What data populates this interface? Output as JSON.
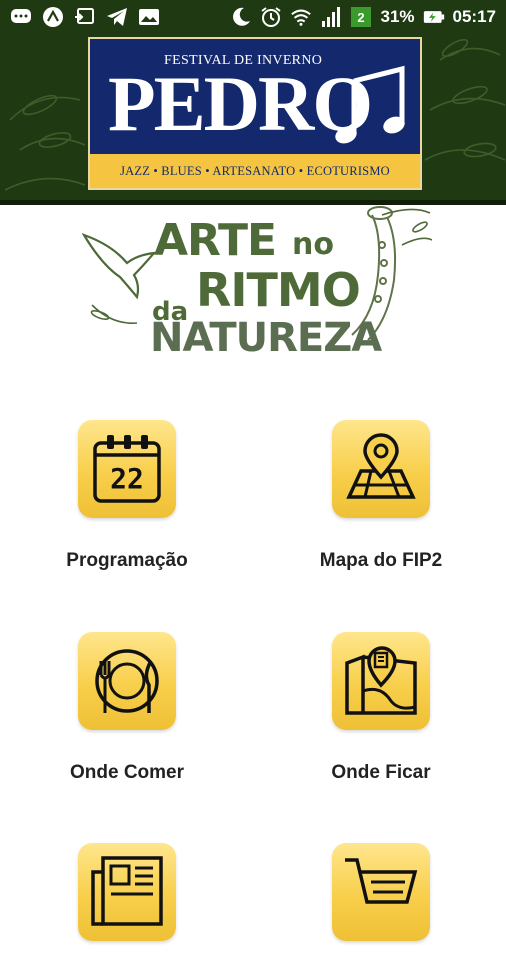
{
  "status_bar": {
    "left_icons": [
      "chat-bubble-icon",
      "a-circle-icon",
      "cast-icon",
      "telegram-icon",
      "image-icon"
    ],
    "right_icons": [
      "moon-icon",
      "alarm-icon",
      "wifi-icon",
      "signal-icon",
      "signal-2g-icon",
      "battery-charging-icon"
    ],
    "battery": "31%",
    "time": "05:17"
  },
  "logo": {
    "festival_text": "FESTIVAL DE INVERNO",
    "name": "PEDRO",
    "strip_text": "JAZZ • BLUES • ARTESANATO • ECOTURISMO",
    "colors": {
      "panel": "#14296d",
      "strip": "#f5c542"
    }
  },
  "slogan": {
    "line1": "ARTE",
    "line1b": "no",
    "line2a": "da",
    "line2b": "RITMO",
    "line3": "NATUREZA"
  },
  "menu": {
    "tile_color": "#f8cf4b",
    "items": [
      {
        "label": "Programação",
        "icon": "calendar-icon"
      },
      {
        "label": "Mapa do FIP2",
        "icon": "map-pin-icon"
      },
      {
        "label": "Onde Comer",
        "icon": "plate-cutlery-icon"
      },
      {
        "label": "Onde Ficar",
        "icon": "hotel-map-icon"
      },
      {
        "label": "",
        "icon": "newspaper-icon"
      },
      {
        "label": "",
        "icon": "shopping-cart-icon"
      }
    ]
  },
  "calendar_day": "22"
}
